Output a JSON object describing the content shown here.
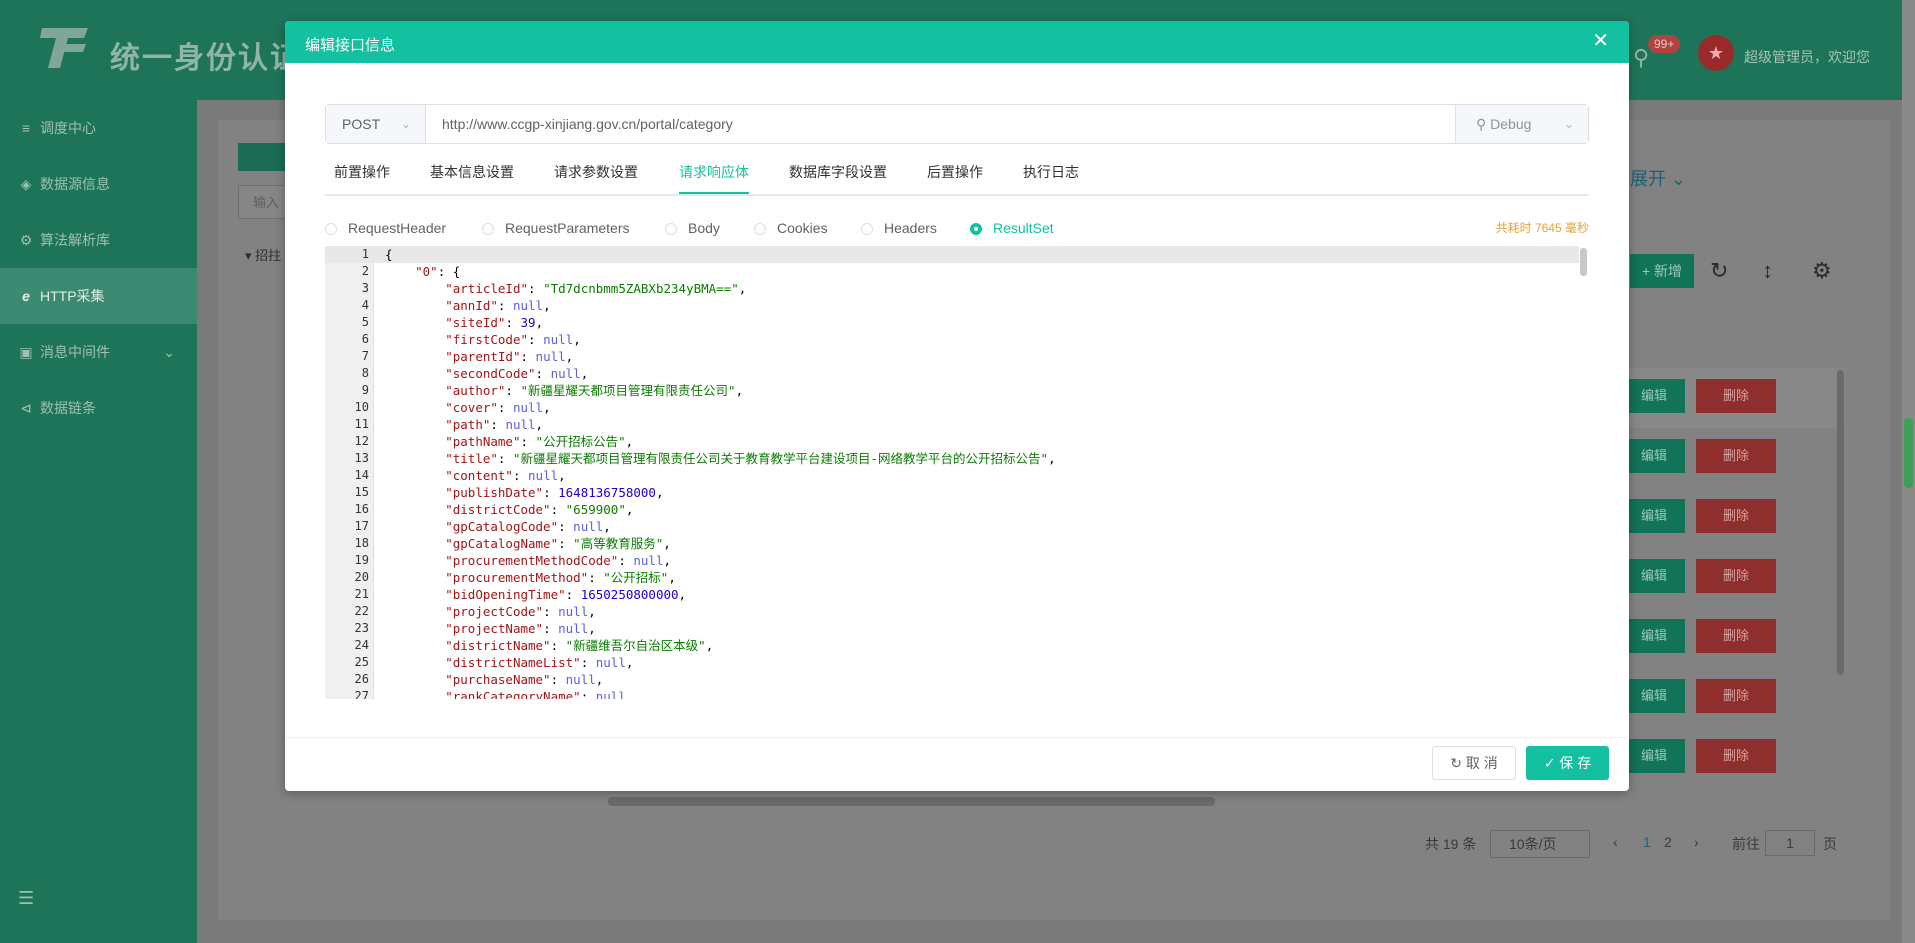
{
  "app": {
    "title": "统一身份认证",
    "welcome": "超级管理员，欢迎您",
    "notification_badge": "99+"
  },
  "sidebar": {
    "items": [
      {
        "label": "调度中心",
        "icon": "sliders-icon"
      },
      {
        "label": "数据源信息",
        "icon": "layers-icon"
      },
      {
        "label": "算法解析库",
        "icon": "gear-icon"
      },
      {
        "label": "HTTP采集",
        "icon": "ie-icon",
        "active": true
      },
      {
        "label": "消息中间件",
        "icon": "monitor-icon",
        "expandable": true
      },
      {
        "label": "数据链条",
        "icon": "share-icon"
      }
    ]
  },
  "background": {
    "left_input_placeholder": "输入",
    "tree_label": "招拄",
    "expand_label": "展开",
    "add_label": "+ 新增",
    "edit_label": "编辑",
    "delete_label": "删除",
    "pager": {
      "total": "共 19 条",
      "page_size": "10条/页",
      "pages": [
        "1",
        "2"
      ],
      "goto_label": "前往",
      "goto_value": "1",
      "page_suffix": "页"
    }
  },
  "modal": {
    "title": "编辑接口信息",
    "method": "POST",
    "url": "http://www.ccgp-xinjiang.gov.cn/portal/category",
    "debug_label": "Debug",
    "tabs": [
      "前置操作",
      "基本信息设置",
      "请求参数设置",
      "请求响应体",
      "数据库字段设置",
      "后置操作",
      "执行日志"
    ],
    "active_tab": "请求响应体",
    "radios": [
      "RequestHeader",
      "RequestParameters",
      "Body",
      "Cookies",
      "Headers",
      "ResultSet"
    ],
    "selected_radio": "ResultSet",
    "elapsed": "共耗时 7645 毫秒",
    "code_lines": [
      "{",
      "    \"0\": {",
      "        \"articleId\": \"Td7dcnbmm5ZABXb234yBMA==\",",
      "        \"annId\": null,",
      "        \"siteId\": 39,",
      "        \"firstCode\": null,",
      "        \"parentId\": null,",
      "        \"secondCode\": null,",
      "        \"author\": \"新疆星耀天都项目管理有限责任公司\",",
      "        \"cover\": null,",
      "        \"path\": null,",
      "        \"pathName\": \"公开招标公告\",",
      "        \"title\": \"新疆星耀天都项目管理有限责任公司关于教育教学平台建设项目-网络教学平台的公开招标公告\",",
      "        \"content\": null,",
      "        \"publishDate\": 1648136758000,",
      "        \"districtCode\": \"659900\",",
      "        \"gpCatalogCode\": null,",
      "        \"gpCatalogName\": \"高等教育服务\",",
      "        \"procurementMethodCode\": null,",
      "        \"procurementMethod\": \"公开招标\",",
      "        \"bidOpeningTime\": 1650250800000,",
      "        \"projectCode\": null,",
      "        \"projectName\": null,",
      "        \"districtName\": \"新疆维吾尔自治区本级\",",
      "        \"districtNameList\": null,",
      "        \"purchaseName\": null,",
      "        \"rankCategoryName\": null"
    ],
    "cancel_label": "取 消",
    "save_label": "保 存"
  },
  "colors": {
    "accent": "#13c0a0",
    "warning": "#e6a23c",
    "sidebar": "#1d7459"
  }
}
